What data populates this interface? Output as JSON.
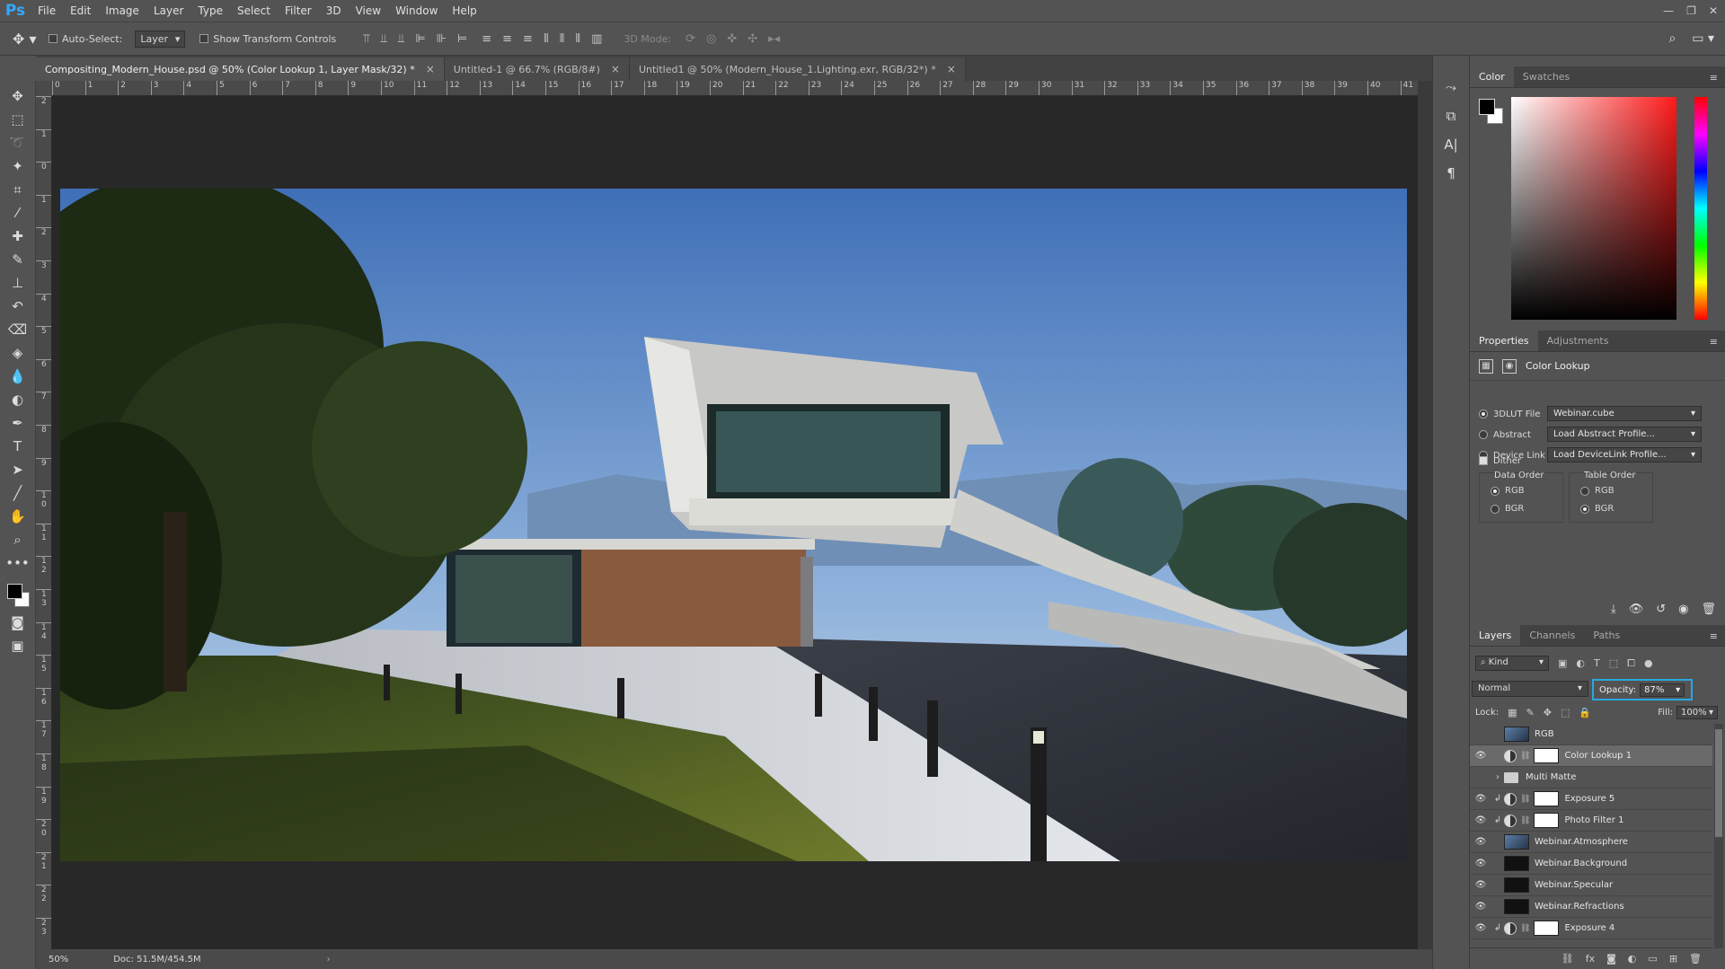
{
  "app": {
    "logo": "Ps"
  },
  "menu": [
    "File",
    "Edit",
    "Image",
    "Layer",
    "Type",
    "Select",
    "Filter",
    "3D",
    "View",
    "Window",
    "Help"
  ],
  "window_controls": [
    "—",
    "❐",
    "✕"
  ],
  "options_bar": {
    "auto_select_label": "Auto-Select:",
    "auto_select_target": "Layer",
    "show_transform_label": "Show Transform Controls",
    "mode_3d_label": "3D Mode:"
  },
  "tabs": [
    {
      "label": "Compositing_Modern_House.psd @ 50% (Color Lookup 1, Layer Mask/32) *",
      "active": true
    },
    {
      "label": "Untitled-1 @ 66.7% (RGB/8#)",
      "active": false
    },
    {
      "label": "Untitled1 @ 50% (Modern_House_1.Lighting.exr, RGB/32*) *",
      "active": false
    }
  ],
  "ruler": {
    "h": [
      "0",
      "1",
      "2",
      "3",
      "4",
      "5",
      "6",
      "7",
      "8",
      "9",
      "10",
      "11",
      "12",
      "13",
      "14",
      "15",
      "16",
      "17",
      "18",
      "19",
      "20",
      "21",
      "22",
      "23",
      "24",
      "25",
      "26",
      "27",
      "28",
      "29",
      "30",
      "31",
      "32",
      "33",
      "34",
      "35",
      "36",
      "37",
      "38",
      "39",
      "40",
      "41"
    ],
    "v": [
      "2",
      "1",
      "0",
      "1",
      "2",
      "3",
      "4",
      "5",
      "6",
      "7",
      "8",
      "9",
      "1 0",
      "1 1",
      "1 2",
      "1 3",
      "1 4",
      "1 5",
      "1 6",
      "1 7",
      "1 8",
      "1 9",
      "2 0",
      "2 1",
      "2 2",
      "2 3"
    ]
  },
  "status": {
    "zoom": "50%",
    "doc": "Doc: 51.5M/454.5M",
    "arrow": "›"
  },
  "color_panel": {
    "tabs": [
      "Color",
      "Swatches"
    ]
  },
  "properties_panel": {
    "tabs": [
      "Properties",
      "Adjustments"
    ],
    "title": "Color Lookup",
    "rows": [
      {
        "label": "3DLUT File",
        "value": "Webinar.cube",
        "checked": true
      },
      {
        "label": "Abstract",
        "value": "Load Abstract Profile...",
        "checked": false
      },
      {
        "label": "Device Link",
        "value": "Load DeviceLink Profile...",
        "checked": false
      }
    ],
    "dither_label": "Dither",
    "data_order": {
      "title": "Data Order",
      "options": [
        "RGB",
        "BGR"
      ],
      "selected": "RGB"
    },
    "table_order": {
      "title": "Table Order",
      "options": [
        "RGB",
        "BGR"
      ],
      "selected": "BGR"
    }
  },
  "layers_panel": {
    "tabs": [
      "Layers",
      "Channels",
      "Paths"
    ],
    "kind_label": "Kind",
    "blend_mode": "Normal",
    "opacity_label": "Opacity:",
    "opacity_value": "87%",
    "lock_label": "Lock:",
    "fill_label": "Fill:",
    "fill_value": "100%",
    "layers": [
      {
        "name": "RGB",
        "type": "image",
        "visible": false,
        "selected": false
      },
      {
        "name": "Color Lookup 1",
        "type": "adjustment",
        "visible": true,
        "selected": true
      },
      {
        "name": "Multi Matte",
        "type": "group",
        "visible": false,
        "selected": false
      },
      {
        "name": "Exposure 5",
        "type": "adjustment-clip",
        "visible": true,
        "selected": false
      },
      {
        "name": "Photo Filter 1",
        "type": "adjustment-clip",
        "visible": true,
        "selected": false
      },
      {
        "name": "Webinar.Atmosphere",
        "type": "smart",
        "visible": true,
        "selected": false
      },
      {
        "name": "Webinar.Background",
        "type": "smart",
        "visible": true,
        "selected": false
      },
      {
        "name": "Webinar.Specular",
        "type": "smart",
        "visible": true,
        "selected": false
      },
      {
        "name": "Webinar.Refractions",
        "type": "smart",
        "visible": true,
        "selected": false
      },
      {
        "name": "Exposure 4",
        "type": "adjustment-clip",
        "visible": true,
        "selected": false
      }
    ]
  },
  "colors": {
    "accent": "#29a8e0",
    "ui_bg": "#535353",
    "canvas_bg": "#282828"
  }
}
